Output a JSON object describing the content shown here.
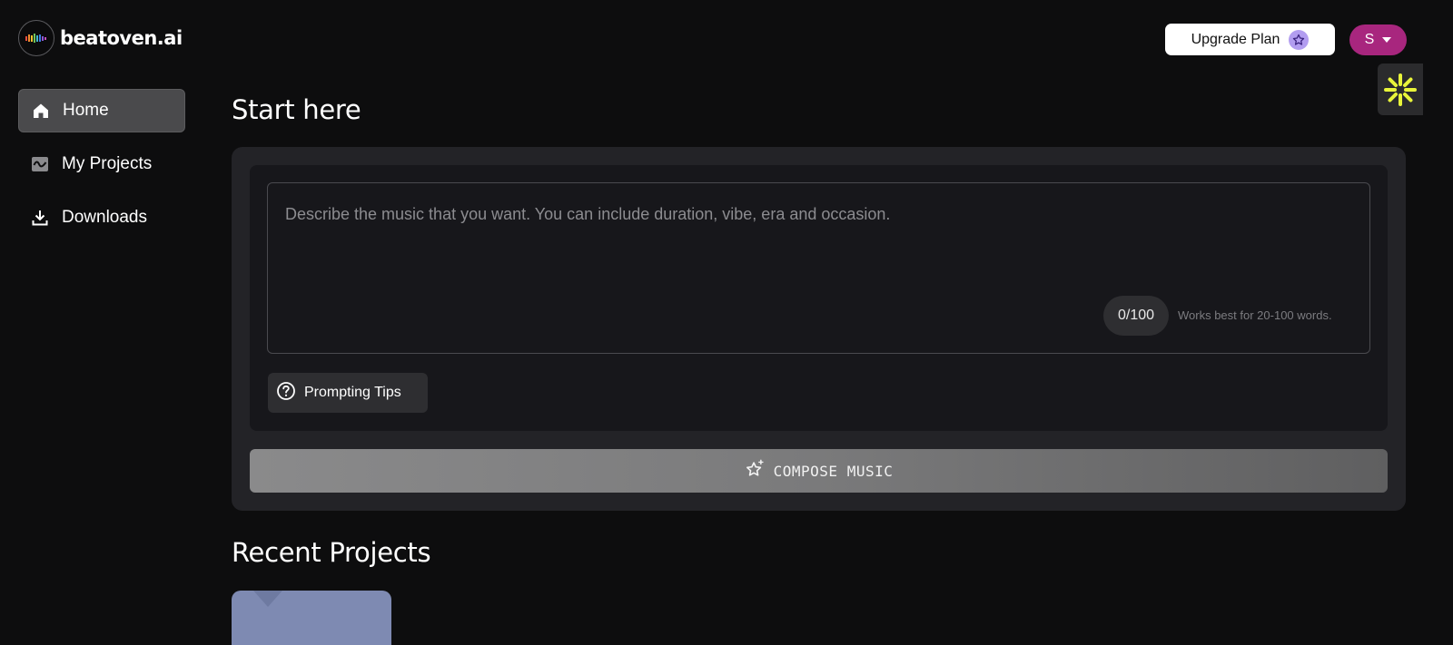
{
  "brand": {
    "name": "beatoven.ai"
  },
  "header": {
    "upgrade_label": "Upgrade Plan",
    "avatar_initial": "S",
    "accent_color": "#a8267e"
  },
  "sidebar": {
    "items": [
      {
        "label": "Home",
        "icon": "home-icon",
        "active": true
      },
      {
        "label": "My Projects",
        "icon": "waveform-icon",
        "active": false
      },
      {
        "label": "Downloads",
        "icon": "download-icon",
        "active": false
      }
    ]
  },
  "main": {
    "start_title": "Start here",
    "prompt": {
      "value": "",
      "placeholder": "Describe the music that you want. You can include duration, vibe, era and occasion.",
      "counter": "0/100",
      "hint": "Works best for 20-100 words."
    },
    "tips_label": "Prompting Tips",
    "compose_label": "COMPOSE MUSIC",
    "recent_title": "Recent Projects"
  }
}
